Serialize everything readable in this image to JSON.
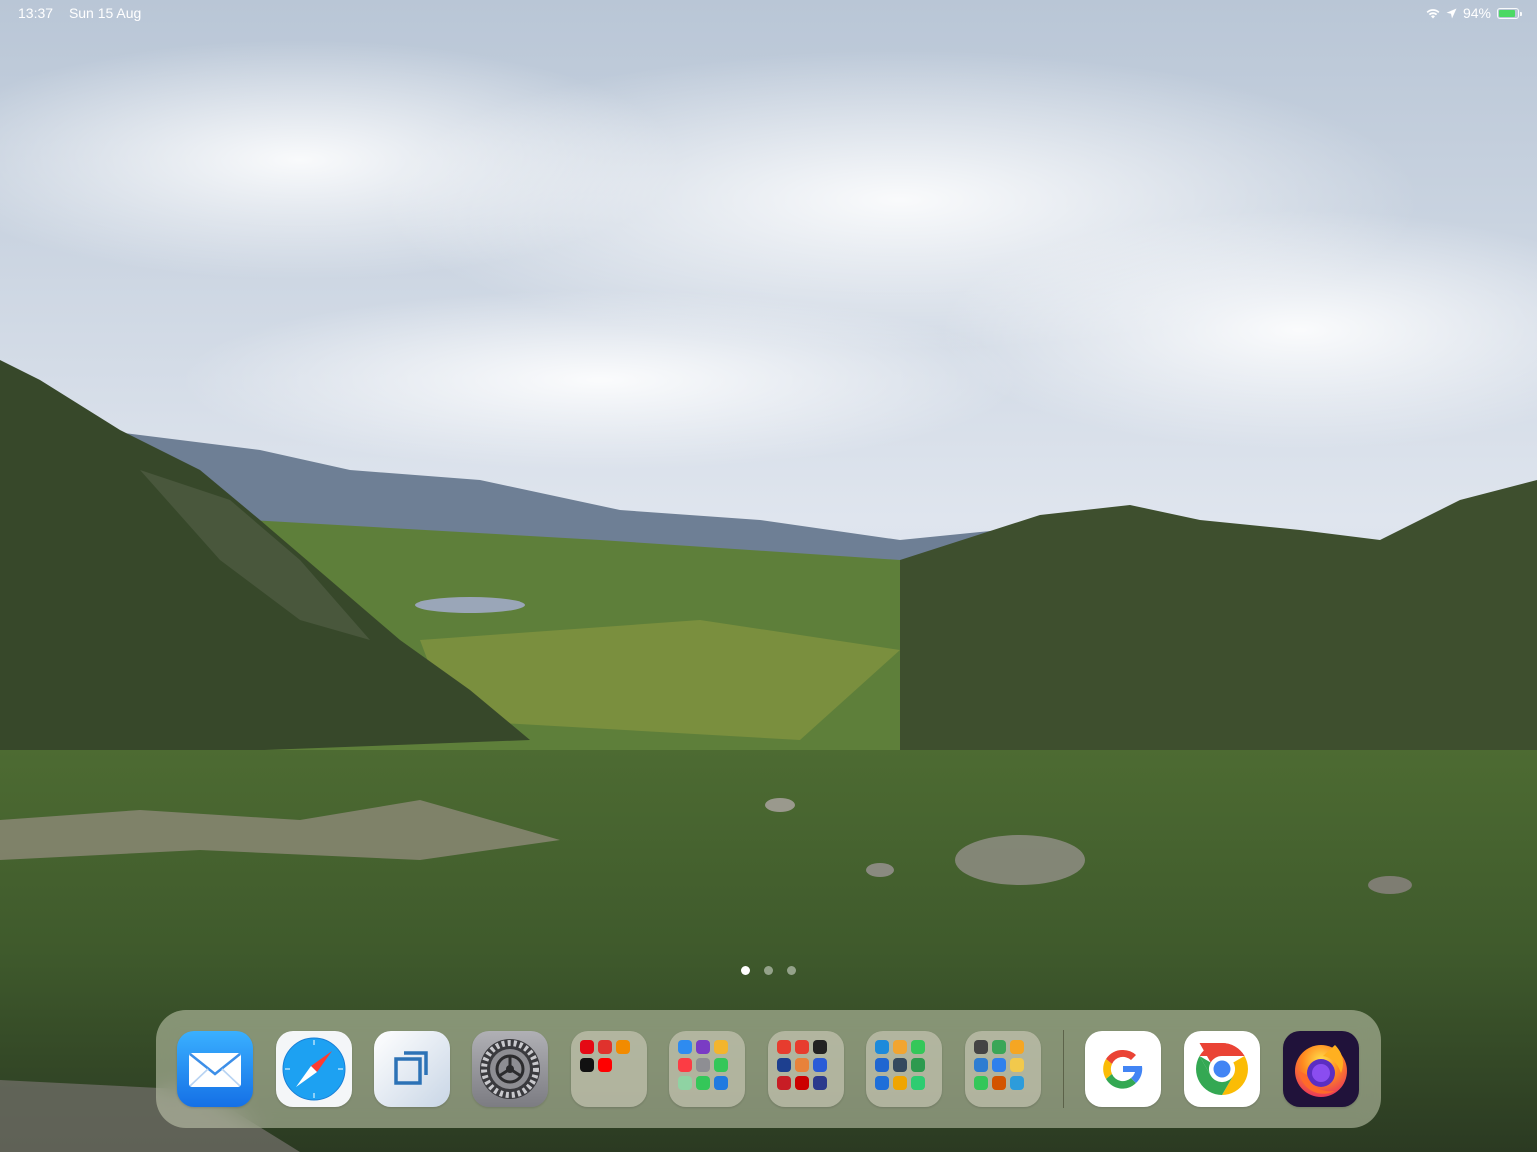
{
  "status_bar": {
    "time": "13:37",
    "date": "Sun 15 Aug",
    "battery_percent": "94%",
    "battery_level": 0.94,
    "icons": [
      "wifi-icon",
      "location-icon",
      "battery-charging-icon"
    ]
  },
  "page_indicator": {
    "pages": 3,
    "current": 1
  },
  "dock": {
    "apps": [
      {
        "name": "mail-app",
        "icon": "envelope"
      },
      {
        "name": "safari-app",
        "icon": "compass"
      },
      {
        "name": "screen-app",
        "icon": "square-arrow"
      },
      {
        "name": "settings-app",
        "icon": "gear"
      }
    ],
    "folders": [
      {
        "name": "entertainment-folder",
        "colors": [
          "#e50914",
          "#e0322d",
          "#f28b00",
          "#111111",
          "#ff0000"
        ]
      },
      {
        "name": "utilities-folder",
        "colors": [
          "#2e8bf0",
          "#7a3cc4",
          "#f3b52d",
          "#fc3c44",
          "#8e8e93",
          "#34c759",
          "#8fd3a3",
          "#34c759",
          "#1f7ae0",
          "#fc3c44",
          "#2f67d8",
          "#1e90ff"
        ]
      },
      {
        "name": "news-folder",
        "colors": [
          "#e73c2e",
          "#e73c2e",
          "#222222",
          "#1d3f8f",
          "#e8823a",
          "#2a5bd7",
          "#c81d25",
          "#cc0000",
          "#2b3a8c",
          "#555555"
        ]
      },
      {
        "name": "tools-folder",
        "colors": [
          "#1c8adb",
          "#f2a531",
          "#34c759",
          "#1f66d1",
          "#34495e",
          "#2d9a4f",
          "#1e6fd9",
          "#f0a500",
          "#2ecc71",
          "#0a84ff",
          "#7d5fff",
          "#333333",
          "#2b6de0",
          "#f0a030"
        ]
      },
      {
        "name": "games-folder",
        "colors": [
          "#444444",
          "#3aa657",
          "#f5a623",
          "#2d7dd2",
          "#2f80ed",
          "#f2c94c",
          "#34c759",
          "#d35400",
          "#2d9cdb",
          "#e74c3c",
          "#c0392b",
          "#9b59b6"
        ]
      }
    ],
    "recent_apps": [
      {
        "name": "google-app",
        "icon": "google-g"
      },
      {
        "name": "chrome-app",
        "icon": "chrome"
      },
      {
        "name": "firefox-app",
        "icon": "firefox"
      }
    ]
  }
}
